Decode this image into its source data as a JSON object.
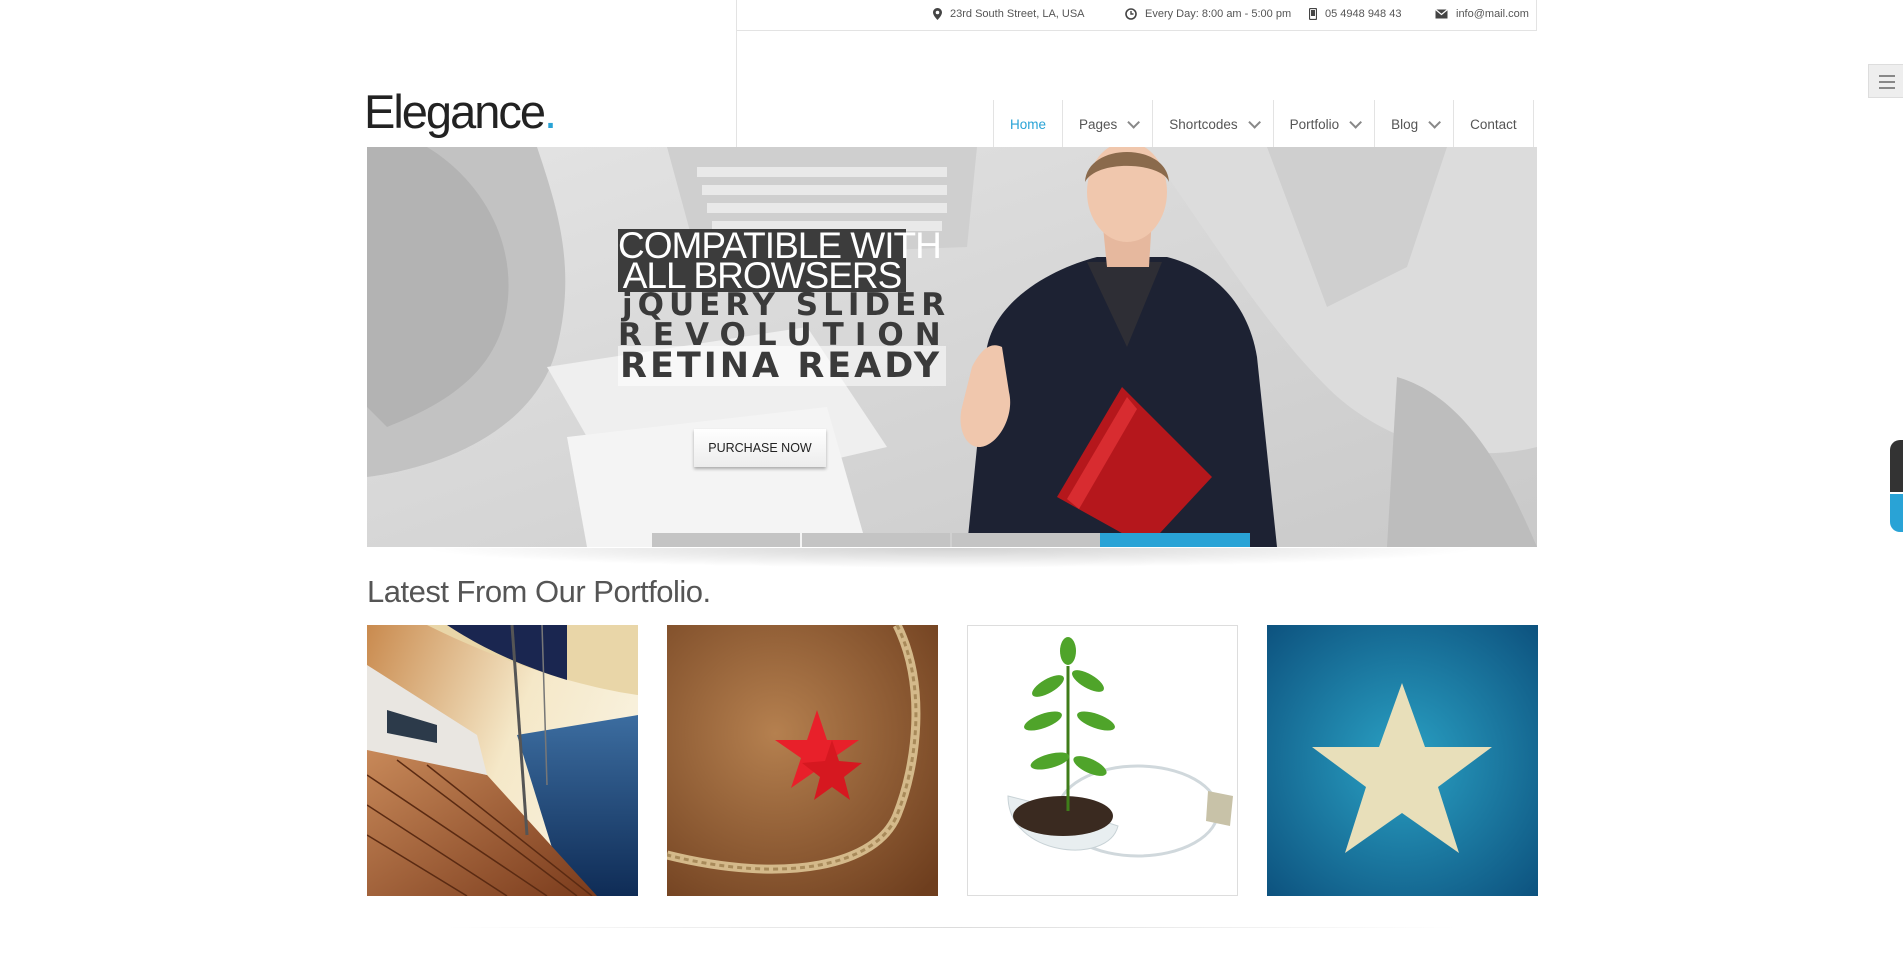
{
  "topbar": {
    "address": "23rd South Street, LA, USA",
    "hours": "Every Day: 8:00 am - 5:00 pm",
    "phone": "05 4948 948 43",
    "email": "info@mail.com"
  },
  "logo": {
    "text": "Elegance",
    "dot": "."
  },
  "nav": {
    "items": [
      {
        "label": "Home",
        "active": true,
        "dropdown": false
      },
      {
        "label": "Pages",
        "dropdown": true
      },
      {
        "label": "Shortcodes",
        "dropdown": true
      },
      {
        "label": "Portfolio",
        "dropdown": true
      },
      {
        "label": "Blog",
        "dropdown": true
      },
      {
        "label": "Contact",
        "dropdown": false
      }
    ]
  },
  "slider": {
    "caption_line1": "COMPATIBLE WITH",
    "caption_line2": "ALL BROWSERS",
    "caption_line3": "jQUERY SLIDER",
    "caption_line4": "REVOLUTION",
    "caption_line5": "RETINA READY",
    "button_label": "PURCHASE NOW",
    "active_bullet": 4,
    "bullet_count": 4
  },
  "portfolio": {
    "title": "Latest From Our Portfolio.",
    "items": [
      {
        "icon": "sailboat-image"
      },
      {
        "icon": "starfish-image"
      },
      {
        "icon": "plant-bulb-image"
      },
      {
        "icon": "star-flag-image"
      }
    ]
  },
  "colors": {
    "accent": "#29a3d6",
    "caption_bg": "#3c3c3c",
    "text": "#555555"
  }
}
